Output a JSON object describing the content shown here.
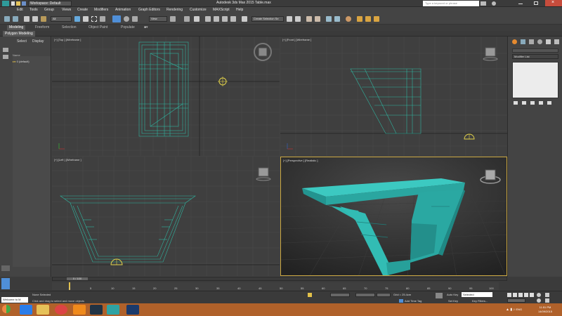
{
  "titlebar": {
    "workspace": "Workspace: Default",
    "title": "Autodesk 3ds Max  2015      Table.max",
    "search_placeholder": "Type a keyword or phrase"
  },
  "menu": [
    "Edit",
    "Tools",
    "Group",
    "Views",
    "Create",
    "Modifiers",
    "Animation",
    "Graph Editors",
    "Rendering",
    "Customize",
    "MAXScript",
    "Help"
  ],
  "toolbar": {
    "selection_filter": "All",
    "ref_coord": "View",
    "named_selection": "Create Selection Se"
  },
  "ribbon": {
    "tabs": [
      "Modeling",
      "Freeform",
      "Selection",
      "Object Paint",
      "Populate"
    ],
    "active_tab": "Modeling",
    "panel": "Polygon Modeling"
  },
  "scene_explorer": {
    "tabs": [
      "Select",
      "Display"
    ],
    "header": "Name",
    "row": "0 (default)"
  },
  "viewports": {
    "top": "[+] [Top ] [Wireframe ]",
    "front": "[+] [Front ] [Wireframe ]",
    "left": "[+] [Left ] [Wireframe ]",
    "perspective": "[+] [Perspective ] [Realistic ]"
  },
  "command_panel": {
    "modifier_list": "Modifier List"
  },
  "timeline": {
    "frame_display": "0 / 100",
    "ticks": [
      "0",
      "5",
      "10",
      "15",
      "20",
      "25",
      "30",
      "35",
      "40",
      "45",
      "50",
      "55",
      "60",
      "65",
      "70",
      "75",
      "80",
      "85",
      "90",
      "95",
      "100"
    ]
  },
  "status": {
    "welcome": "Welcome to M",
    "selection": "None Selected",
    "prompt": "Click and drag to select and move objects",
    "grid": "Grid = 25.4cm",
    "add_time_tag": "Add Time Tag",
    "auto_key": "Auto Key",
    "set_key": "Set Key",
    "selected": "Selected",
    "key_filters": "Key Filters..."
  },
  "taskbar": {
    "time": "11:51 PM",
    "date": "14/09/2015",
    "lang": "ENG"
  },
  "colors": {
    "wire": "#2fb5a0",
    "mesh": "#2fb5b0",
    "viewport_bg": "#3f3f3f",
    "persp_border": "#c9a640",
    "taskbar": "#b0612a"
  }
}
